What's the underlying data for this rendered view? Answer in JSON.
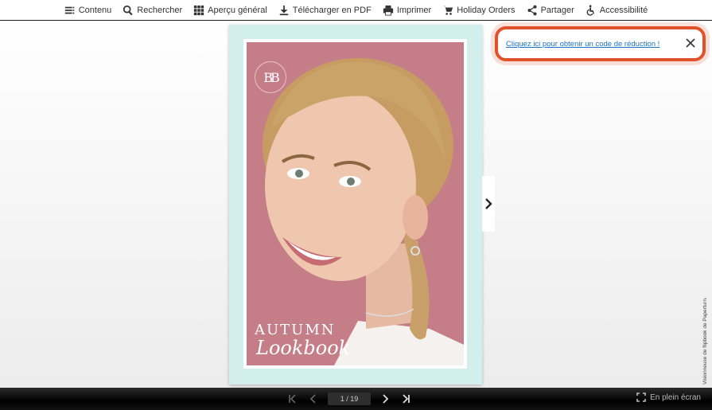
{
  "toolbar": {
    "items": [
      {
        "label": "Contenu",
        "icon": "menu-icon"
      },
      {
        "label": "Rechercher",
        "icon": "search-icon"
      },
      {
        "label": "Aperçu général",
        "icon": "grid-icon"
      },
      {
        "label": "Télécharger en PDF",
        "icon": "download-icon"
      },
      {
        "label": "Imprimer",
        "icon": "print-icon"
      },
      {
        "label": "Holiday Orders",
        "icon": "cart-icon"
      },
      {
        "label": "Partager",
        "icon": "share-icon"
      },
      {
        "label": "Accessibilité",
        "icon": "accessibility-icon"
      }
    ]
  },
  "cover": {
    "logo": "BB",
    "title": "AUTUMN",
    "subtitle": "Lookbook",
    "background_color": "#d2efed",
    "photo_color": "#c57e88"
  },
  "promo": {
    "link_text": "Cliquez ici pour obtenir un code de réduction !",
    "accent_color": "#e2522a",
    "close_icon": "close-icon"
  },
  "credit": "Visionneuse de flipbook de Paperturn.",
  "pager": {
    "page_indicator": "1 / 19"
  },
  "fullscreen": {
    "label": "En plein écran"
  }
}
